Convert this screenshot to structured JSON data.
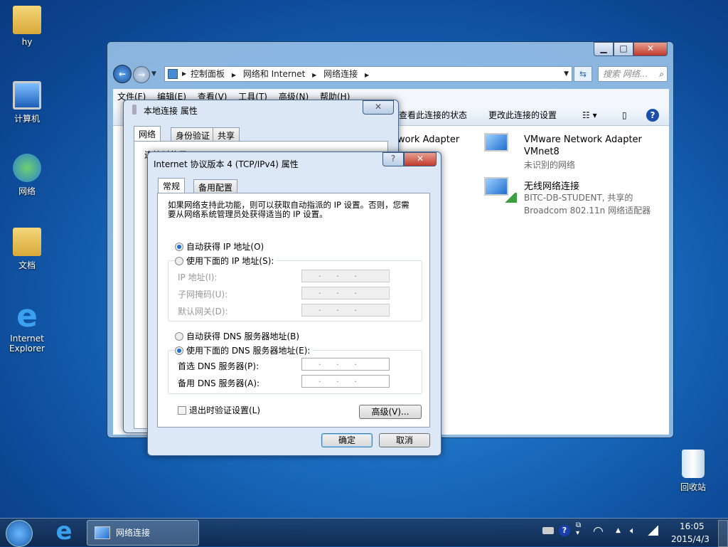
{
  "desktop": {
    "icons": [
      {
        "label": "hy",
        "icon": "user-folder-icon"
      },
      {
        "label": "计算机",
        "icon": "computer-icon"
      },
      {
        "label": "网络",
        "icon": "network-icon"
      },
      {
        "label": "文档",
        "icon": "documents-folder-icon"
      },
      {
        "label": "Internet Explorer",
        "icon": "ie-icon"
      },
      {
        "label": "回收站",
        "icon": "recycle-bin-icon"
      }
    ]
  },
  "explorer": {
    "breadcrumb": [
      "控制面板",
      "网络和 Internet",
      "网络连接"
    ],
    "search_placeholder": "搜索 网络...",
    "menu": [
      "文件(F)",
      "编辑(E)",
      "查看(V)",
      "工具(T)",
      "高级(N)",
      "帮助(H)"
    ],
    "toolbar": {
      "view_status": "查看此连接的状态",
      "change_settings": "更改此连接的设置"
    },
    "adapters": [
      {
        "partial_name": "work Adapter"
      },
      {
        "name": "VMware Network Adapter VMnet8",
        "line1": "VMware Network Adapter",
        "line2": "VMnet8",
        "status": "未识别的网络"
      },
      {
        "name": "无线网络连接",
        "status": "BITC-DB-STUDENT, 共享的",
        "device": "Broadcom 802.11n 网络适配器"
      }
    ]
  },
  "local_props": {
    "title": "本地连接 属性",
    "tabs": [
      "网络",
      "身份验证",
      "共享"
    ],
    "connect_using": "连接时使用:"
  },
  "ipv4": {
    "title": "Internet 协议版本 4 (TCP/IPv4) 属性",
    "tabs": [
      "常规",
      "备用配置"
    ],
    "description": "如果网络支持此功能，则可以获取自动指派的 IP 设置。否则，您需要从网络系统管理员处获得适当的 IP 设置。",
    "auto_ip": "自动获得 IP 地址(O)",
    "manual_ip": "使用下面的 IP 地址(S):",
    "ip_label": "IP 地址(I):",
    "mask_label": "子网掩码(U):",
    "gateway_label": "默认网关(D):",
    "auto_dns": "自动获得 DNS 服务器地址(B)",
    "manual_dns": "使用下面的 DNS 服务器地址(E):",
    "dns1_label": "首选 DNS 服务器(P):",
    "dns2_label": "备用 DNS 服务器(A):",
    "ip_placeholder": "...",
    "validate": "退出时验证设置(L)",
    "validate_checked": false,
    "advanced": "高级(V)...",
    "ok": "确定",
    "cancel": "取消",
    "selected_ip_mode": "auto",
    "selected_dns_mode": "manual"
  },
  "taskbar": {
    "task": "网络连接",
    "time": "16:05",
    "date": "2015/4/3"
  }
}
